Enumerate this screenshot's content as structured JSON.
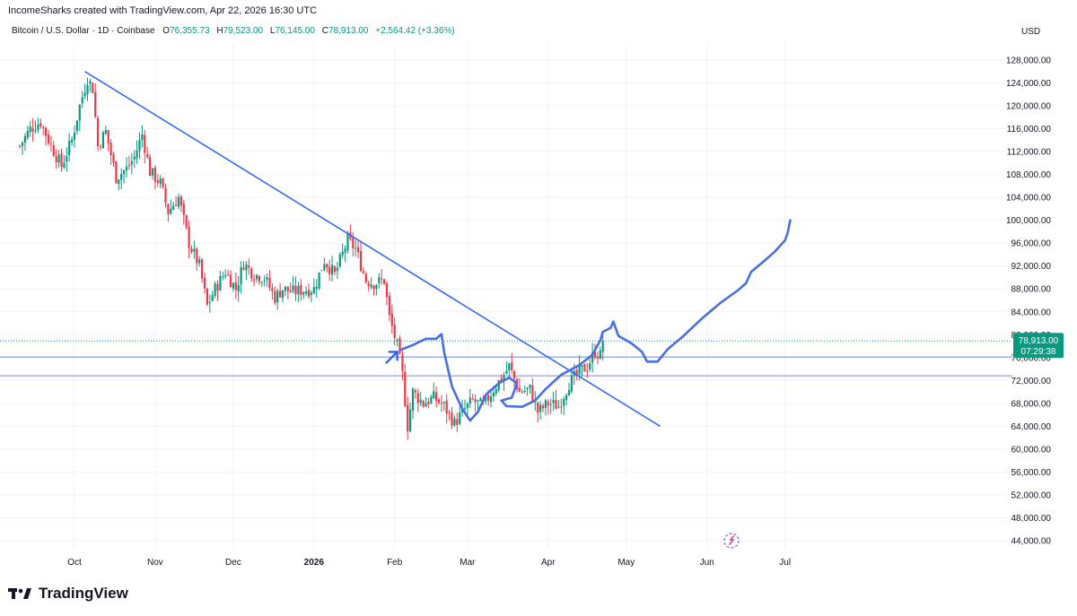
{
  "caption": "IncomeSharks created with TradingView.com, Apr 22, 2026 16:30 UTC",
  "symbol": {
    "name": "Bitcoin / U.S. Dollar · 1D · Coinbase",
    "open_label": "O",
    "open": "76,355.73",
    "high_label": "H",
    "high": "79,523.00",
    "low_label": "L",
    "low": "76,145.00",
    "close_label": "C",
    "close": "78,913.00",
    "change": "+2,564.42 (+3.36%)"
  },
  "currency": "USD",
  "price_badge": {
    "price": "78,913.00",
    "countdown": "07:29:38"
  },
  "logo_text": "TradingView",
  "colors": {
    "up": "#089981",
    "down": "#f23645",
    "trendline": "#2962ff",
    "drawing": "#4a6fe3",
    "zone": "#9aa9e8",
    "badge": "#089981"
  },
  "chart_data": {
    "type": "candlestick",
    "y_ticks": [
      44000,
      48000,
      52000,
      56000,
      60000,
      64000,
      68000,
      72000,
      76000,
      80000,
      84000,
      88000,
      92000,
      96000,
      100000,
      104000,
      108000,
      112000,
      116000,
      120000,
      124000,
      128000
    ],
    "y_tick_labels": [
      "44,000.00",
      "48,000.00",
      "52,000.00",
      "56,000.00",
      "60,000.00",
      "64,000.00",
      "68,000.00",
      "72,000.00",
      "76,000.00",
      "80,000.00",
      "84,000.00",
      "88,000.00",
      "92,000.00",
      "96,000.00",
      "100,000.00",
      "104,000.00",
      "108,000.00",
      "112,000.00",
      "116,000.00",
      "120,000.00",
      "124,000.00",
      "128,000.00"
    ],
    "x_ticks": [
      {
        "date": "2025-10-01",
        "label": "Oct",
        "bold": false
      },
      {
        "date": "2025-11-01",
        "label": "Nov",
        "bold": false
      },
      {
        "date": "2025-12-01",
        "label": "Dec",
        "bold": false
      },
      {
        "date": "2026-01-01",
        "label": "2026",
        "bold": true
      },
      {
        "date": "2026-02-01",
        "label": "Feb",
        "bold": false
      },
      {
        "date": "2026-03-01",
        "label": "Mar",
        "bold": false
      },
      {
        "date": "2026-04-01",
        "label": "Apr",
        "bold": false
      },
      {
        "date": "2026-05-01",
        "label": "May",
        "bold": false
      },
      {
        "date": "2026-06-01",
        "label": "Jun",
        "bold": false
      },
      {
        "date": "2026-07-01",
        "label": "Jul",
        "bold": false
      }
    ],
    "x_range": [
      "2025-09-10",
      "2026-07-20"
    ],
    "y_range": [
      42000,
      131000
    ],
    "last_close": 78913,
    "close_points": [
      [
        "2025-09-10",
        113000
      ],
      [
        "2025-09-14",
        116000
      ],
      [
        "2025-09-18",
        117200
      ],
      [
        "2025-09-22",
        113000
      ],
      [
        "2025-09-26",
        109500
      ],
      [
        "2025-09-30",
        114000
      ],
      [
        "2025-10-03",
        120000
      ],
      [
        "2025-10-06",
        124800
      ],
      [
        "2025-10-08",
        123000
      ],
      [
        "2025-10-10",
        113000
      ],
      [
        "2025-10-13",
        115500
      ],
      [
        "2025-10-17",
        107500
      ],
      [
        "2025-10-21",
        109000
      ],
      [
        "2025-10-24",
        111000
      ],
      [
        "2025-10-27",
        115000
      ],
      [
        "2025-10-30",
        108500
      ],
      [
        "2025-11-03",
        106500
      ],
      [
        "2025-11-06",
        101500
      ],
      [
        "2025-11-10",
        104000
      ],
      [
        "2025-11-14",
        96000
      ],
      [
        "2025-11-18",
        92000
      ],
      [
        "2025-11-21",
        85000
      ],
      [
        "2025-11-24",
        88000
      ],
      [
        "2025-11-28",
        91000
      ],
      [
        "2025-12-02",
        88000
      ],
      [
        "2025-12-05",
        92500
      ],
      [
        "2025-12-09",
        90500
      ],
      [
        "2025-12-13",
        90000
      ],
      [
        "2025-12-17",
        86500
      ],
      [
        "2025-12-20",
        88000
      ],
      [
        "2025-12-24",
        87500
      ],
      [
        "2025-12-28",
        87800
      ],
      [
        "2026-01-01",
        88000
      ],
      [
        "2026-01-05",
        93000
      ],
      [
        "2026-01-09",
        90500
      ],
      [
        "2026-01-14",
        96500
      ],
      [
        "2026-01-17",
        95000
      ],
      [
        "2026-01-21",
        89500
      ],
      [
        "2026-01-24",
        89000
      ],
      [
        "2026-01-28",
        89500
      ],
      [
        "2026-01-30",
        83000
      ],
      [
        "2026-02-02",
        78000
      ],
      [
        "2026-02-04",
        73000
      ],
      [
        "2026-02-06",
        64000
      ],
      [
        "2026-02-08",
        70000
      ],
      [
        "2026-02-12",
        68000
      ],
      [
        "2026-02-16",
        69000
      ],
      [
        "2026-02-20",
        67500
      ],
      [
        "2026-02-24",
        64500
      ],
      [
        "2026-02-28",
        67000
      ],
      [
        "2026-03-03",
        68500
      ],
      [
        "2026-03-07",
        67500
      ],
      [
        "2026-03-11",
        70500
      ],
      [
        "2026-03-15",
        73000
      ],
      [
        "2026-03-17",
        74500
      ],
      [
        "2026-03-21",
        70000
      ],
      [
        "2026-03-25",
        70500
      ],
      [
        "2026-03-28",
        66500
      ],
      [
        "2026-04-01",
        68000
      ],
      [
        "2026-04-05",
        67500
      ],
      [
        "2026-04-09",
        71500
      ],
      [
        "2026-04-13",
        73500
      ],
      [
        "2026-04-16",
        74500
      ],
      [
        "2026-04-19",
        77000
      ],
      [
        "2026-04-21",
        76355
      ],
      [
        "2026-04-22",
        78913
      ]
    ],
    "trendline": [
      [
        "2025-10-05",
        126000
      ],
      [
        "2026-05-14",
        64000
      ]
    ],
    "zone_lines": [
      76100,
      72800
    ],
    "projection": [
      [
        "2026-02-03",
        77300
      ],
      [
        "2026-02-08",
        78200
      ],
      [
        "2026-02-13",
        79300
      ],
      [
        "2026-02-17",
        79300
      ],
      [
        "2026-02-19",
        80100
      ],
      [
        "2026-02-20",
        77000
      ],
      [
        "2026-02-23",
        71000
      ],
      [
        "2026-02-27",
        67000
      ],
      [
        "2026-03-02",
        65000
      ],
      [
        "2026-03-05",
        66500
      ],
      [
        "2026-03-08",
        69500
      ],
      [
        "2026-03-13",
        71500
      ],
      [
        "2026-03-17",
        72500
      ],
      [
        "2026-03-20",
        71500
      ],
      [
        "2026-03-18",
        69000
      ],
      [
        "2026-03-14",
        68500
      ],
      [
        "2026-03-16",
        67500
      ],
      [
        "2026-03-22",
        67400
      ],
      [
        "2026-03-27",
        68500
      ],
      [
        "2026-03-31",
        70500
      ],
      [
        "2026-04-06",
        73000
      ],
      [
        "2026-04-13",
        74700
      ],
      [
        "2026-04-18",
        76500
      ],
      [
        "2026-04-21",
        79000
      ],
      [
        "2026-04-22",
        80500
      ],
      [
        "2026-04-25",
        81200
      ],
      [
        "2026-04-26",
        82300
      ],
      [
        "2026-04-28",
        79800
      ],
      [
        "2026-05-03",
        78500
      ],
      [
        "2026-05-07",
        77000
      ],
      [
        "2026-05-09",
        75300
      ],
      [
        "2026-05-13",
        75300
      ],
      [
        "2026-05-17",
        77500
      ],
      [
        "2026-05-23",
        79800
      ],
      [
        "2026-05-30",
        82800
      ],
      [
        "2026-06-06",
        85500
      ],
      [
        "2026-06-13",
        87800
      ],
      [
        "2026-06-16",
        89000
      ],
      [
        "2026-06-18",
        91000
      ],
      [
        "2026-06-22",
        92500
      ],
      [
        "2026-06-27",
        94500
      ],
      [
        "2026-07-01",
        96500
      ],
      [
        "2026-07-02",
        97800
      ],
      [
        "2026-07-03",
        100000
      ]
    ]
  }
}
